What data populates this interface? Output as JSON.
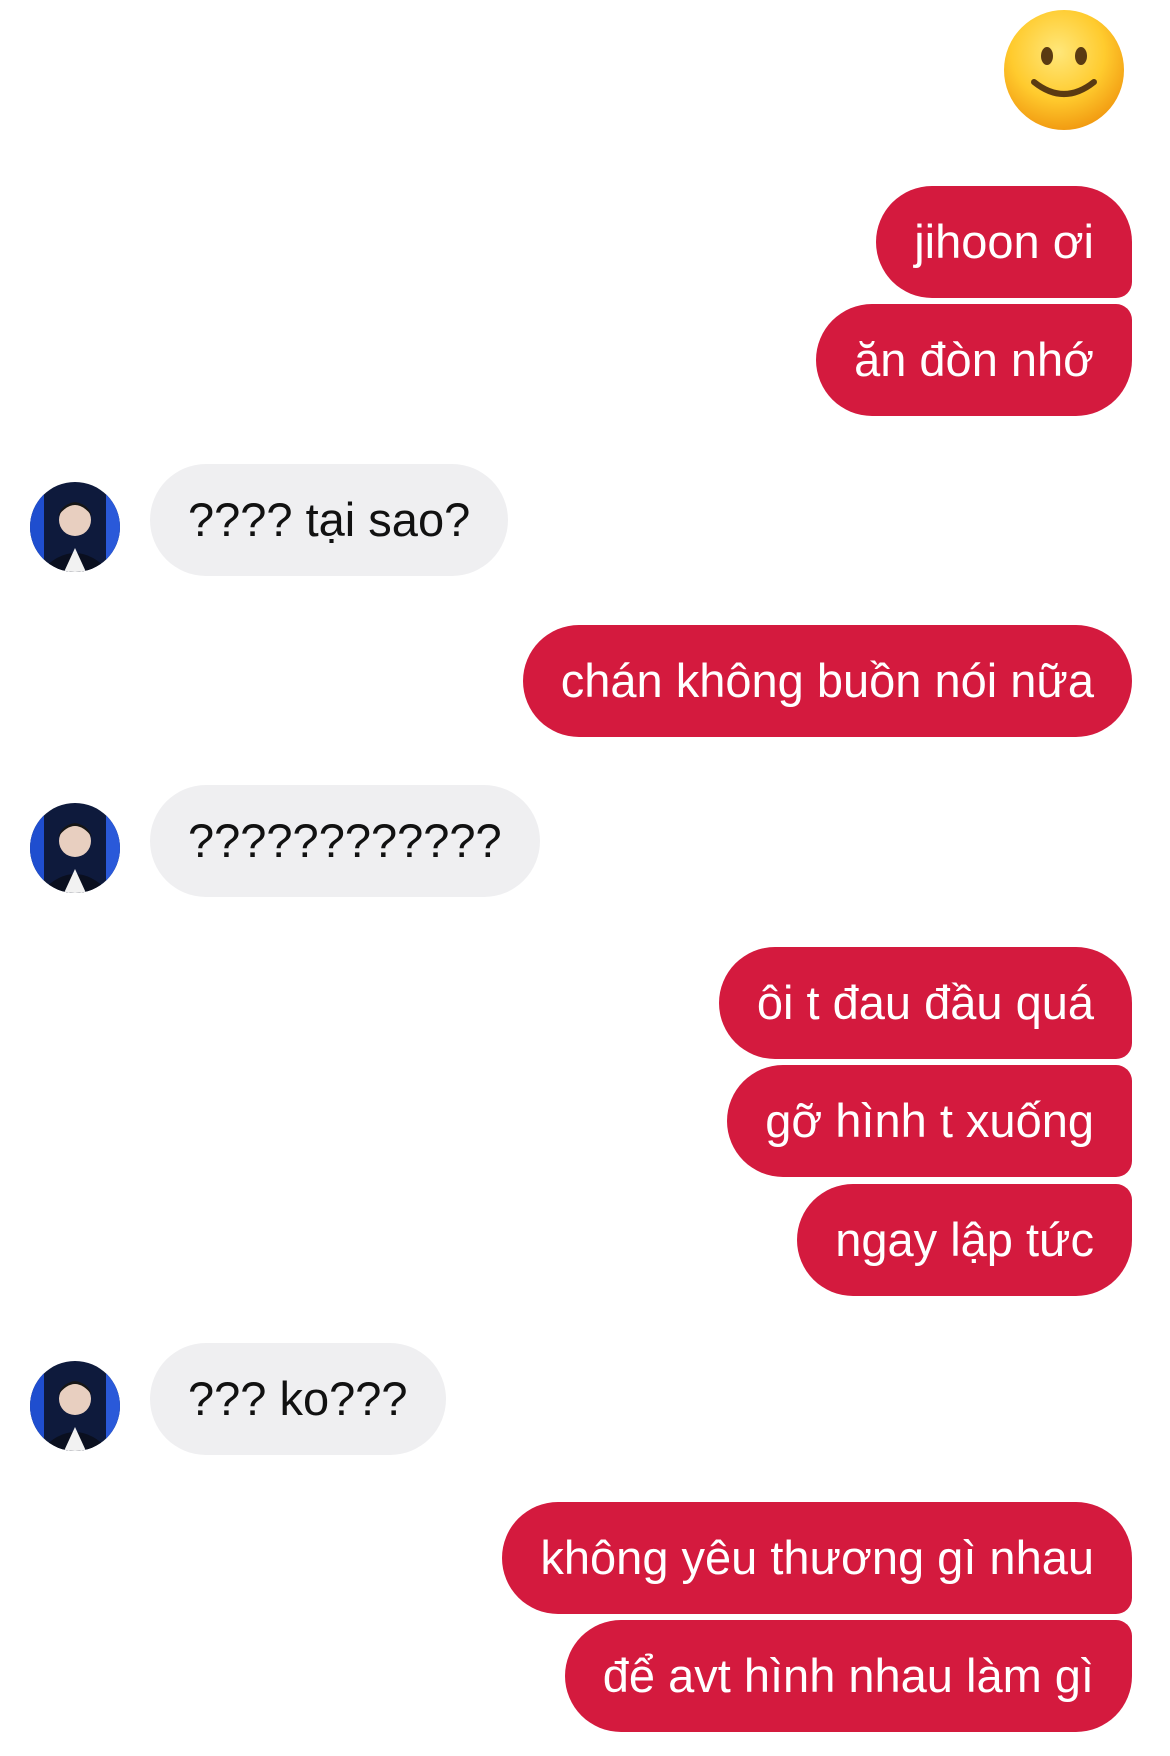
{
  "reaction": {
    "icon": "slightly-smiling-face-emoji"
  },
  "contact": {
    "avatar_icon": "contact-avatar-photo"
  },
  "messages": [
    {
      "side": "sent",
      "text": "jihoon ơi"
    },
    {
      "side": "sent",
      "text": "ăn đòn nhớ"
    },
    {
      "side": "received",
      "text": "???? tại sao?"
    },
    {
      "side": "sent",
      "text": "chán không buồn nói nữa"
    },
    {
      "side": "received",
      "text": "????????????"
    },
    {
      "side": "sent",
      "text": "ôi t đau đầu quá"
    },
    {
      "side": "sent",
      "text": "gỡ hình t xuống"
    },
    {
      "side": "sent",
      "text": "ngay lập tức"
    },
    {
      "side": "received",
      "text": "??? ko???"
    },
    {
      "side": "sent",
      "text": "không yêu thương gì nhau"
    },
    {
      "side": "sent",
      "text": "để avt hình nhau làm gì"
    }
  ],
  "colors": {
    "sent_bubble": "#d41a3e",
    "sent_text": "#ffffff",
    "received_bubble": "#efeff1",
    "received_text": "#111111"
  }
}
